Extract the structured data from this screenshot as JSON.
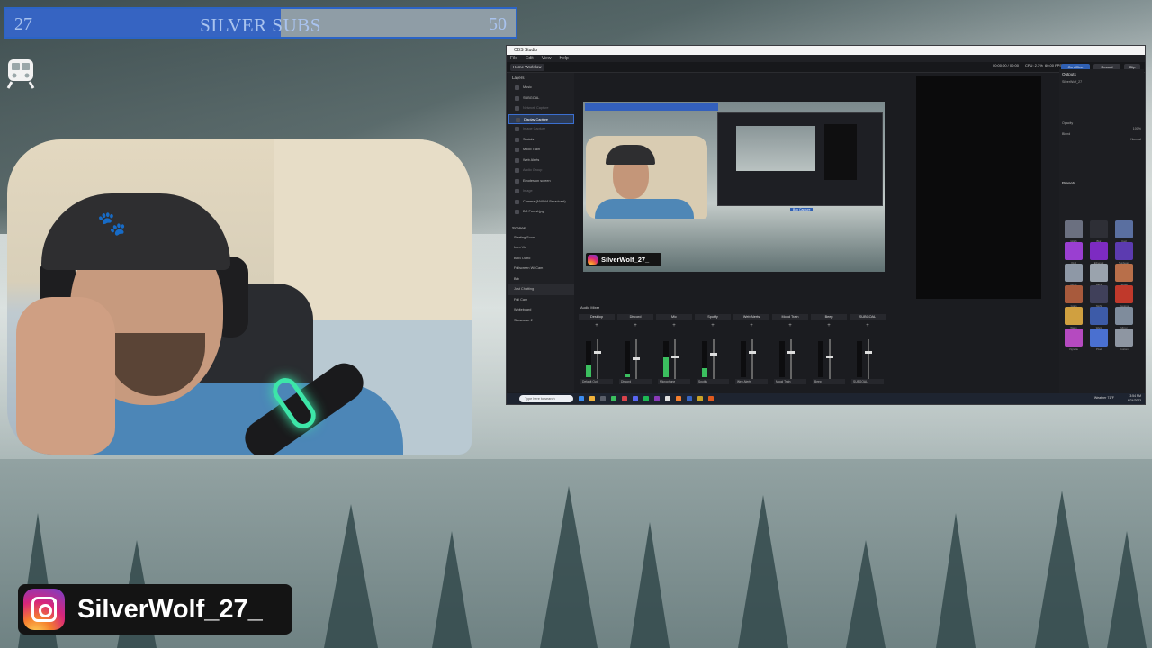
{
  "subgoal": {
    "current": "27",
    "title": "SILVER SUBS",
    "target": "50",
    "progress": 0.54
  },
  "instagram": {
    "handle": "SilverWolf_27_"
  },
  "obs": {
    "window_title": "OBS Studio",
    "menu": [
      "File",
      "Edit",
      "View",
      "Help"
    ],
    "toolbar_tab": "Home Workflow",
    "stats": [
      "00:00:00 / 00:00",
      "CPU: 2.3%",
      "60.00 FPS"
    ],
    "buttons": {
      "go_offline": "Go offline",
      "record": "Record",
      "clip": "Clip"
    },
    "sources_title": "Layers",
    "sources": [
      {
        "label": "Music",
        "state": "normal"
      },
      {
        "label": "SUBGOAL",
        "state": "normal"
      },
      {
        "label": "Network Capture",
        "state": "dim"
      },
      {
        "label": "Display Capture",
        "state": "selected"
      },
      {
        "label": "Image Capture",
        "state": "dim"
      },
      {
        "label": "Socials",
        "state": "normal"
      },
      {
        "label": "Mood Train",
        "state": "normal"
      },
      {
        "label": "Web Alerts",
        "state": "normal"
      },
      {
        "label": "Audio Group",
        "state": "dim"
      },
      {
        "label": "Emotes on screen",
        "state": "normal"
      },
      {
        "label": "Image",
        "state": "dim"
      },
      {
        "label": "Camera (NVIDIA Broadcast)",
        "state": "normal"
      },
      {
        "label": "BG Forest.jpg",
        "state": "normal"
      }
    ],
    "scenes_title": "Scenes",
    "scenes": [
      {
        "label": "Starting Soon",
        "selected": false
      },
      {
        "label": "Intro Vid",
        "selected": false
      },
      {
        "label": "BRB Outro",
        "selected": false
      },
      {
        "label": "Fullscreen W/ Cam",
        "selected": false
      },
      {
        "label": "Brb",
        "selected": false
      },
      {
        "label": "Just Chatting",
        "selected": true
      },
      {
        "label": "Full Cam",
        "selected": false
      },
      {
        "label": "Whiteboard",
        "selected": false
      },
      {
        "label": "Showcase 2",
        "selected": false
      }
    ],
    "preview": {
      "ig_handle": "SilverWolf_27_",
      "label": "Box Capture"
    },
    "mixer_title": "Audio Mixer",
    "channels": [
      {
        "name": "Desktop",
        "level": 0.35,
        "fader": 0.7,
        "source": "Default Out"
      },
      {
        "name": "Discord",
        "level": 0.1,
        "fader": 0.55,
        "source": "Discord"
      },
      {
        "name": "Mic",
        "level": 0.55,
        "fader": 0.6,
        "source": "Microphone"
      },
      {
        "name": "Spotify",
        "level": 0.25,
        "fader": 0.65,
        "source": "Spotify"
      },
      {
        "name": "Web Alerts",
        "level": 0.0,
        "fader": 0.7,
        "source": "Web Alerts"
      },
      {
        "name": "Mood Train",
        "level": 0.0,
        "fader": 0.7,
        "source": "Mood Train"
      },
      {
        "name": "Beep",
        "level": 0.0,
        "fader": 0.6,
        "source": "Beep"
      },
      {
        "name": "SUBGOAL",
        "level": 0.0,
        "fader": 0.7,
        "source": "SUBGOAL"
      }
    ],
    "right_panel": {
      "outputs_title": "Outputs",
      "channel_name": "SilverWolf_27",
      "opacity_label": "Opacity",
      "opacity_value": "100%",
      "blend_label": "Blend",
      "blend_value": "Normal",
      "filters_title": "Presets",
      "filters": [
        "Glitch",
        "Blur",
        "Cool",
        "Vivid",
        "Ethereal",
        "Sunbeam",
        "Arctic",
        "Haze",
        "Sepia",
        "Grain",
        "Night",
        "Duotone",
        "Warm",
        "Warp",
        "Mirror",
        "Vignette",
        "Pixel",
        "Custom"
      ]
    },
    "taskbar": {
      "search": "Type here to search",
      "news": "Weather 71°F",
      "time": "3:54 PM",
      "date": "6/24/2023"
    }
  },
  "colors": {
    "subgoal_fill": "#3664c2",
    "subgoal_text": "#a9c3ee",
    "accent": "#2f5fb2",
    "meter": "#3bbf5f"
  }
}
